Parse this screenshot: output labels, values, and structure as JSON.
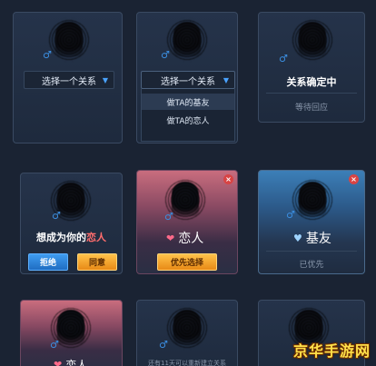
{
  "row1": {
    "card1": {
      "select_label": "选择一个关系"
    },
    "card2": {
      "select_label": "选择一个关系",
      "options": [
        "做TA的基友",
        "做TA的恋人"
      ]
    },
    "card3": {
      "status": "关系确定中",
      "sub_status": "等待回应"
    }
  },
  "row2": {
    "card1": {
      "prompt_prefix": "想成为你的",
      "prompt_highlight": "恋人",
      "reject_label": "拒绝",
      "accept_label": "同意"
    },
    "card2": {
      "relation_label": "恋人",
      "priority_label": "优先选择"
    },
    "card3": {
      "relation_label": "基友",
      "prioritized_label": "已优先"
    }
  },
  "row3": {
    "card1": {
      "relation_label": "恋人"
    },
    "card2": {
      "note": "还有11天可以重新建立关系"
    }
  },
  "watermark": "京华手游网",
  "colors": {
    "accent_blue": "#3b8ee0",
    "highlight_red": "#ff6d6d",
    "button_orange": "#f0a020",
    "button_blue": "#2f86de"
  }
}
